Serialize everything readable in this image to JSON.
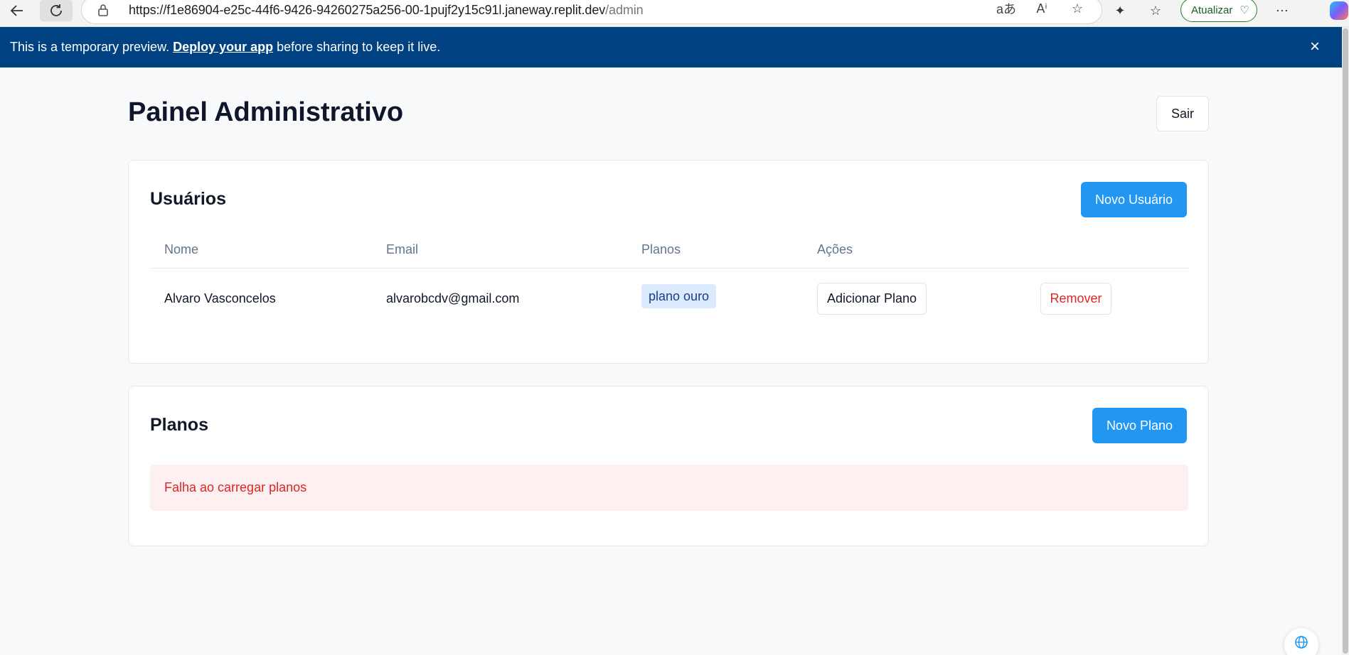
{
  "browser": {
    "url_host": "https://f1e86904-e25c-44f6-9426-94260275a256-00-1pujf2y15c91l.janeway.replit.dev",
    "url_path": "/admin",
    "update_label": "Atualizar"
  },
  "banner": {
    "text_before": "This is a temporary preview.",
    "link": "Deploy your app",
    "text_after": "before sharing to keep it live."
  },
  "header": {
    "title": "Painel Administrativo",
    "logout_label": "Sair"
  },
  "users": {
    "title": "Usuários",
    "new_button": "Novo Usuário",
    "columns": [
      "Nome",
      "Email",
      "Planos",
      "Ações"
    ],
    "rows": [
      {
        "name": "Alvaro Vasconcelos",
        "email": "alvarobcdv@gmail.com",
        "plan": "plano ouro",
        "add_plan_label": "Adicionar Plano",
        "remove_label": "Remover"
      }
    ]
  },
  "plans": {
    "title": "Planos",
    "new_button": "Novo Plano",
    "error": "Falha ao carregar planos"
  },
  "colors": {
    "banner_bg": "#004182",
    "primary": "#2196f3",
    "danger": "#dc2626",
    "error_bg": "#fef0f0",
    "badge_bg": "#dbeafe"
  }
}
